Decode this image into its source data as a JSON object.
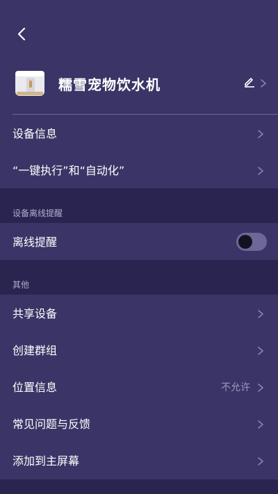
{
  "device": {
    "name": "糯雪宠物饮水机"
  },
  "icons": {
    "back": "back-arrow-icon",
    "edit": "pencil-icon",
    "chevron": "chevron-right-icon",
    "device": "water-fountain-device-icon"
  },
  "group1": {
    "items": [
      {
        "label": "设备信息"
      },
      {
        "label": "“一键执行”和“自动化”"
      }
    ]
  },
  "offline": {
    "section_title": "设备离线提醒",
    "label": "离线提醒",
    "toggle_on": false
  },
  "other": {
    "section_title": "其他",
    "items": [
      {
        "label": "共享设备",
        "value": ""
      },
      {
        "label": "创建群组",
        "value": ""
      },
      {
        "label": "位置信息",
        "value": "不允许"
      },
      {
        "label": "常见问题与反馈",
        "value": ""
      },
      {
        "label": "添加到主屏幕",
        "value": ""
      }
    ]
  },
  "colors": {
    "background": "#2a2550",
    "panel": "#3a3566",
    "text": "#ffffff",
    "muted": "#9c98bd",
    "toggle_track": "#6d6898",
    "toggle_knob": "#141220"
  }
}
